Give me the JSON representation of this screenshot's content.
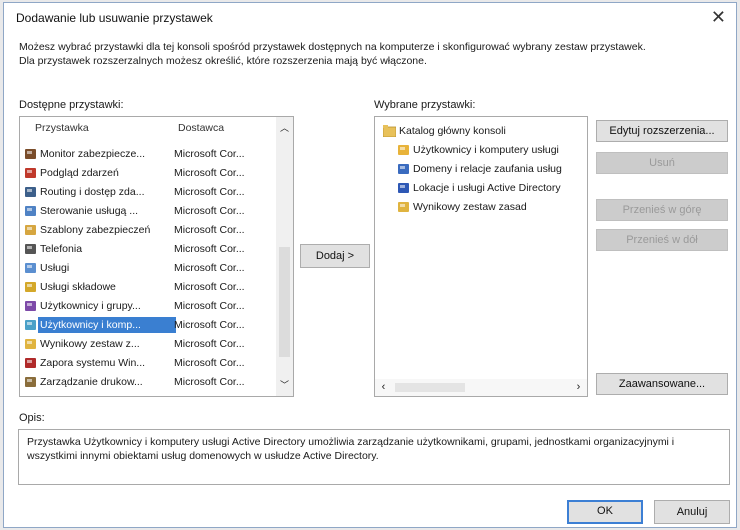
{
  "window": {
    "title": "Dodawanie lub usuwanie przystawek",
    "close_glyph": "✕"
  },
  "intro": {
    "line1": "Możesz wybrać przystawki dla tej konsoli spośród przystawek dostępnych na komputerze i skonfigurować wybrany zestaw przystawek.",
    "line2": "Dla przystawek rozszerzalnych możesz określić, które rozszerzenia mają być włączone."
  },
  "available": {
    "label": "Dostępne przystawki:",
    "col_name": "Przystawka",
    "col_vendor": "Dostawca",
    "items": [
      {
        "name": "Monitor zabezpiecze...",
        "vendor": "Microsoft Cor...",
        "icon": "monitor-icon",
        "color": "#7a4d2a"
      },
      {
        "name": "Podgląd zdarzeń",
        "vendor": "Microsoft Cor...",
        "icon": "event-viewer-icon",
        "color": "#c0392b"
      },
      {
        "name": "Routing i dostęp zda...",
        "vendor": "Microsoft Cor...",
        "icon": "routing-icon",
        "color": "#3c5f8a"
      },
      {
        "name": "Sterowanie usługą ...",
        "vendor": "Microsoft Cor...",
        "icon": "service-control-icon",
        "color": "#4f82c4"
      },
      {
        "name": "Szablony zabezpieczeń",
        "vendor": "Microsoft Cor...",
        "icon": "security-template-icon",
        "color": "#d6a640"
      },
      {
        "name": "Telefonia",
        "vendor": "Microsoft Cor...",
        "icon": "telephony-icon",
        "color": "#555555"
      },
      {
        "name": "Usługi",
        "vendor": "Microsoft Cor...",
        "icon": "services-icon",
        "color": "#5b8fd0"
      },
      {
        "name": "Usługi składowe",
        "vendor": "Microsoft Cor...",
        "icon": "component-services-icon",
        "color": "#d4a82a"
      },
      {
        "name": "Użytkownicy i grupy...",
        "vendor": "Microsoft Cor...",
        "icon": "users-groups-icon",
        "color": "#7d4aa8"
      },
      {
        "name": "Użytkownicy i komp...",
        "vendor": "Microsoft Cor...",
        "icon": "ad-users-computers-icon",
        "color": "#4aa0c8",
        "selected": true
      },
      {
        "name": "Wynikowy zestaw z...",
        "vendor": "Microsoft Cor...",
        "icon": "rsop-icon",
        "color": "#e0b440"
      },
      {
        "name": "Zapora systemu Win...",
        "vendor": "Microsoft Cor...",
        "icon": "firewall-icon",
        "color": "#b02a2a"
      },
      {
        "name": "Zarządzanie drukow...",
        "vendor": "Microsoft Cor...",
        "icon": "print-management-icon",
        "color": "#8a6d3b"
      }
    ]
  },
  "add_button": "Dodaj >",
  "selected": {
    "label": "Wybrane przystawki:",
    "root": {
      "name": "Katalog główny konsoli",
      "icon": "folder-icon",
      "color": "#e8c15a"
    },
    "children": [
      {
        "name": "Użytkownicy i komputery usługi",
        "icon": "ad-users-computers-icon",
        "color": "#e8b33a"
      },
      {
        "name": "Domeny i relacje zaufania usług",
        "icon": "domains-trusts-icon",
        "color": "#3a6bbf"
      },
      {
        "name": "Lokacje i usługi Active Directory",
        "icon": "sites-services-icon",
        "color": "#2e58b5"
      },
      {
        "name": "Wynikowy zestaw zasad",
        "icon": "rsop-icon",
        "color": "#e0b440"
      }
    ]
  },
  "buttons": {
    "edit_extensions": "Edytuj rozszerzenia...",
    "remove": "Usuń",
    "move_up": "Przenieś w górę",
    "move_down": "Przenieś w dół",
    "advanced": "Zaawansowane...",
    "ok": "OK",
    "cancel": "Anuluj"
  },
  "description": {
    "label": "Opis:",
    "text": "Przystawka Użytkownicy i komputery usługi Active Directory umożliwia zarządzanie użytkownikami, grupami, jednostkami organizacyjnymi i wszystkimi innymi obiektami usług domenowych w usłudze Active Directory."
  },
  "colors": {
    "selection": "#3a7fd1",
    "border_accent": "#3c7fd4"
  }
}
